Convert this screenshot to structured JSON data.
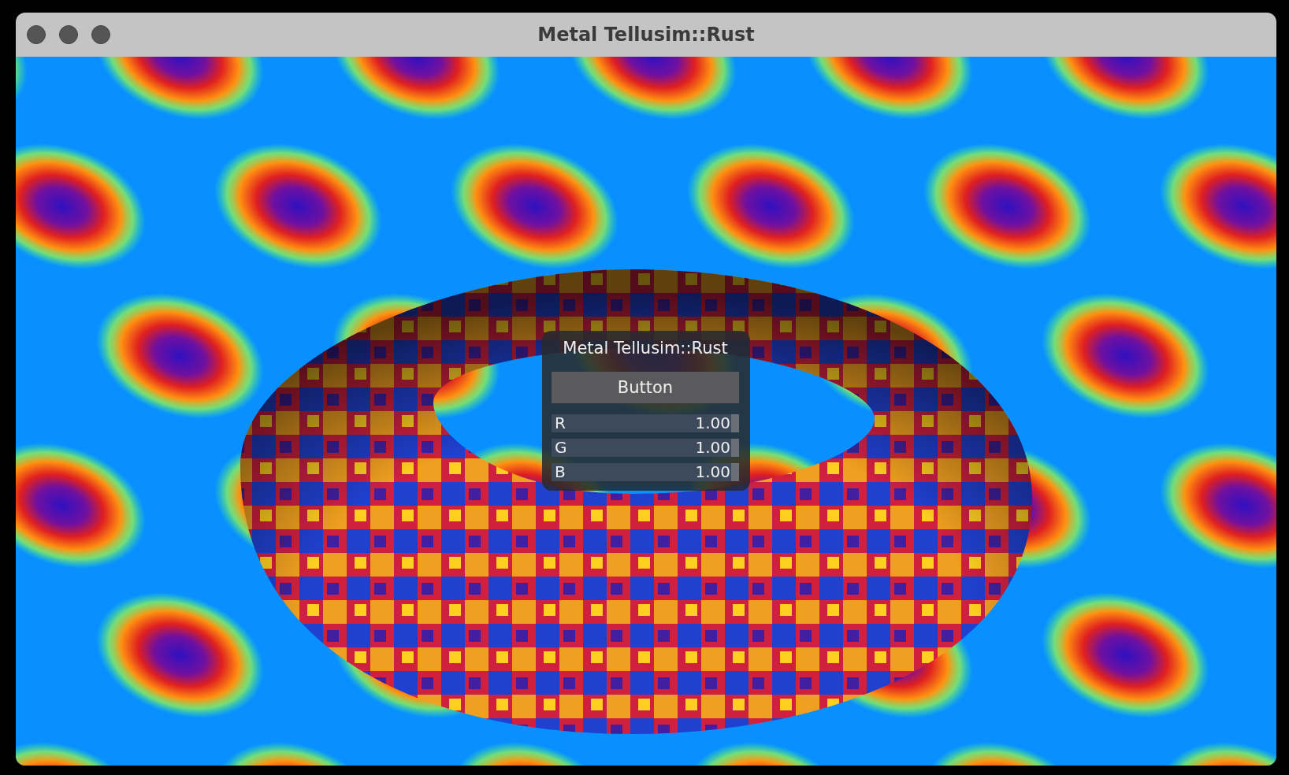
{
  "window": {
    "title": "Metal Tellusim::Rust"
  },
  "panel": {
    "title": "Metal Tellusim::Rust",
    "button": "Button",
    "sliders": [
      {
        "label": "R",
        "value": "1.00",
        "level": 1
      },
      {
        "label": "G",
        "value": "1.00",
        "level": 1
      },
      {
        "label": "B",
        "value": "1.00",
        "level": 1
      }
    ]
  }
}
